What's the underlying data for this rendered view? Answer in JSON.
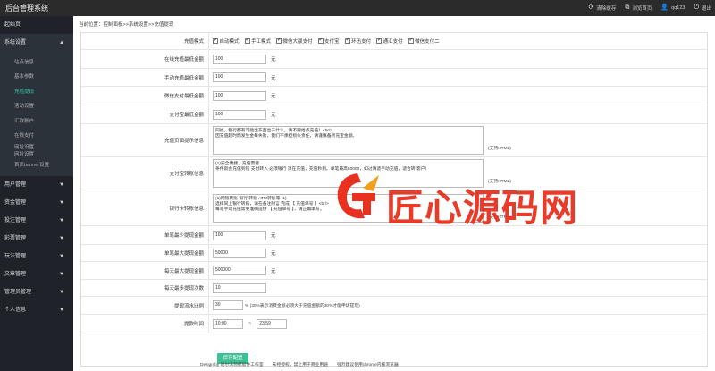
{
  "topbar": {
    "title": "后台管理系统",
    "actions": [
      {
        "icon": "refresh-icon",
        "label": "清除缓存"
      },
      {
        "icon": "external-link-icon",
        "label": "浏览首页"
      },
      {
        "icon": "user-icon",
        "label": "qq123"
      },
      {
        "icon": "power-icon",
        "label": "退出"
      }
    ]
  },
  "sidebar": {
    "home": "起始页",
    "system_group": "系统设置",
    "system_items": [
      "站点信息",
      "基本参数",
      "充值提现",
      "活动设置",
      "汇款账户",
      "在线支付",
      "网址设置\n网址设置",
      "首页banner设置"
    ],
    "groups": [
      "用户管理",
      "资金管理",
      "投注管理",
      "彩票管理",
      "玩法管理",
      "文章管理",
      "管理员管理",
      "个人信息"
    ]
  },
  "breadcrumb": "当前位置：控制面板>>系统设置>>充值提现",
  "form": {
    "mode_label": "充值模式",
    "modes": [
      "自动模式",
      "手工模式",
      "微信大额支付",
      "支付宝",
      "环迅支付",
      "通汇支付",
      "微信支付二"
    ],
    "online_min_label": "在线充值最低金额",
    "online_min_value": "100",
    "manual_min_label": "手动充值最低金额",
    "manual_min_value": "100",
    "wechat_min_label": "微信支付最低金额",
    "wechat_min_value": "100",
    "alipay_min_label": "支付宝最低金额",
    "alipay_min_value": "100",
    "unit": "元",
    "recharge_tip_label": "充值页面提示信息",
    "recharge_tip_value": "同福，银行都有可能出东西出于什么。请不要给点充值！<br/>\n因充值超时而发生金每失败，我们不承担损失责任，请谨慎备所充宝金额。",
    "alipay_tip_label": "支付宝转账信息",
    "alipay_tip_value": "(1)安全便捷，充值需要\n 条件就会充值到钱 支付转入 必须银行 须在充值，充值秒到。单笔最高50000，如过请适手动充值，适合转 客户）",
    "bank_tip_label": "银行卡转账信息",
    "bank_tip_value": "(1)网银转账 银行 转账 ATM转账等 (1)\n选择同上银行转账，请在备注附言 完成 【 充值单号 】<br/>\n 每笔手动充值需要准确提供 【 充值单号 】，请正确填写。",
    "support_html": "(支持HTML)",
    "single_min_withdraw_label": "单笔最少提现金额",
    "single_min_withdraw_value": "100",
    "single_max_withdraw_label": "单笔最大提现金额",
    "single_max_withdraw_value": "50000",
    "daily_max_withdraw_label": "每天最大提现金额",
    "daily_max_withdraw_value": "500000",
    "daily_count_label": "每天最多提现次数",
    "daily_count_value": "10",
    "ratio_label": "提现流水比例",
    "ratio_value": "30",
    "ratio_note": "% (30%表示消费金额必须大于充值金额的30%才能申请提现)",
    "time_label": "提款时间",
    "time_start": "10:00",
    "time_sep": "~",
    "time_end": "23:59",
    "save_label": "保存配置"
  },
  "footer": {
    "credit": "Design by 哈尔滨领航软件工作室",
    "notice": "未经授权，禁止用于商业用途",
    "browser": "强烈建议使用chrome内核浏览器"
  },
  "watermark": {
    "text": "匠心源码网",
    "color": "#e8311f"
  },
  "colors": {
    "topbar": "#2b2b2b",
    "sidebar": "#1f2329",
    "accent": "#3cc195",
    "active_menu": "#2ec4a0"
  }
}
